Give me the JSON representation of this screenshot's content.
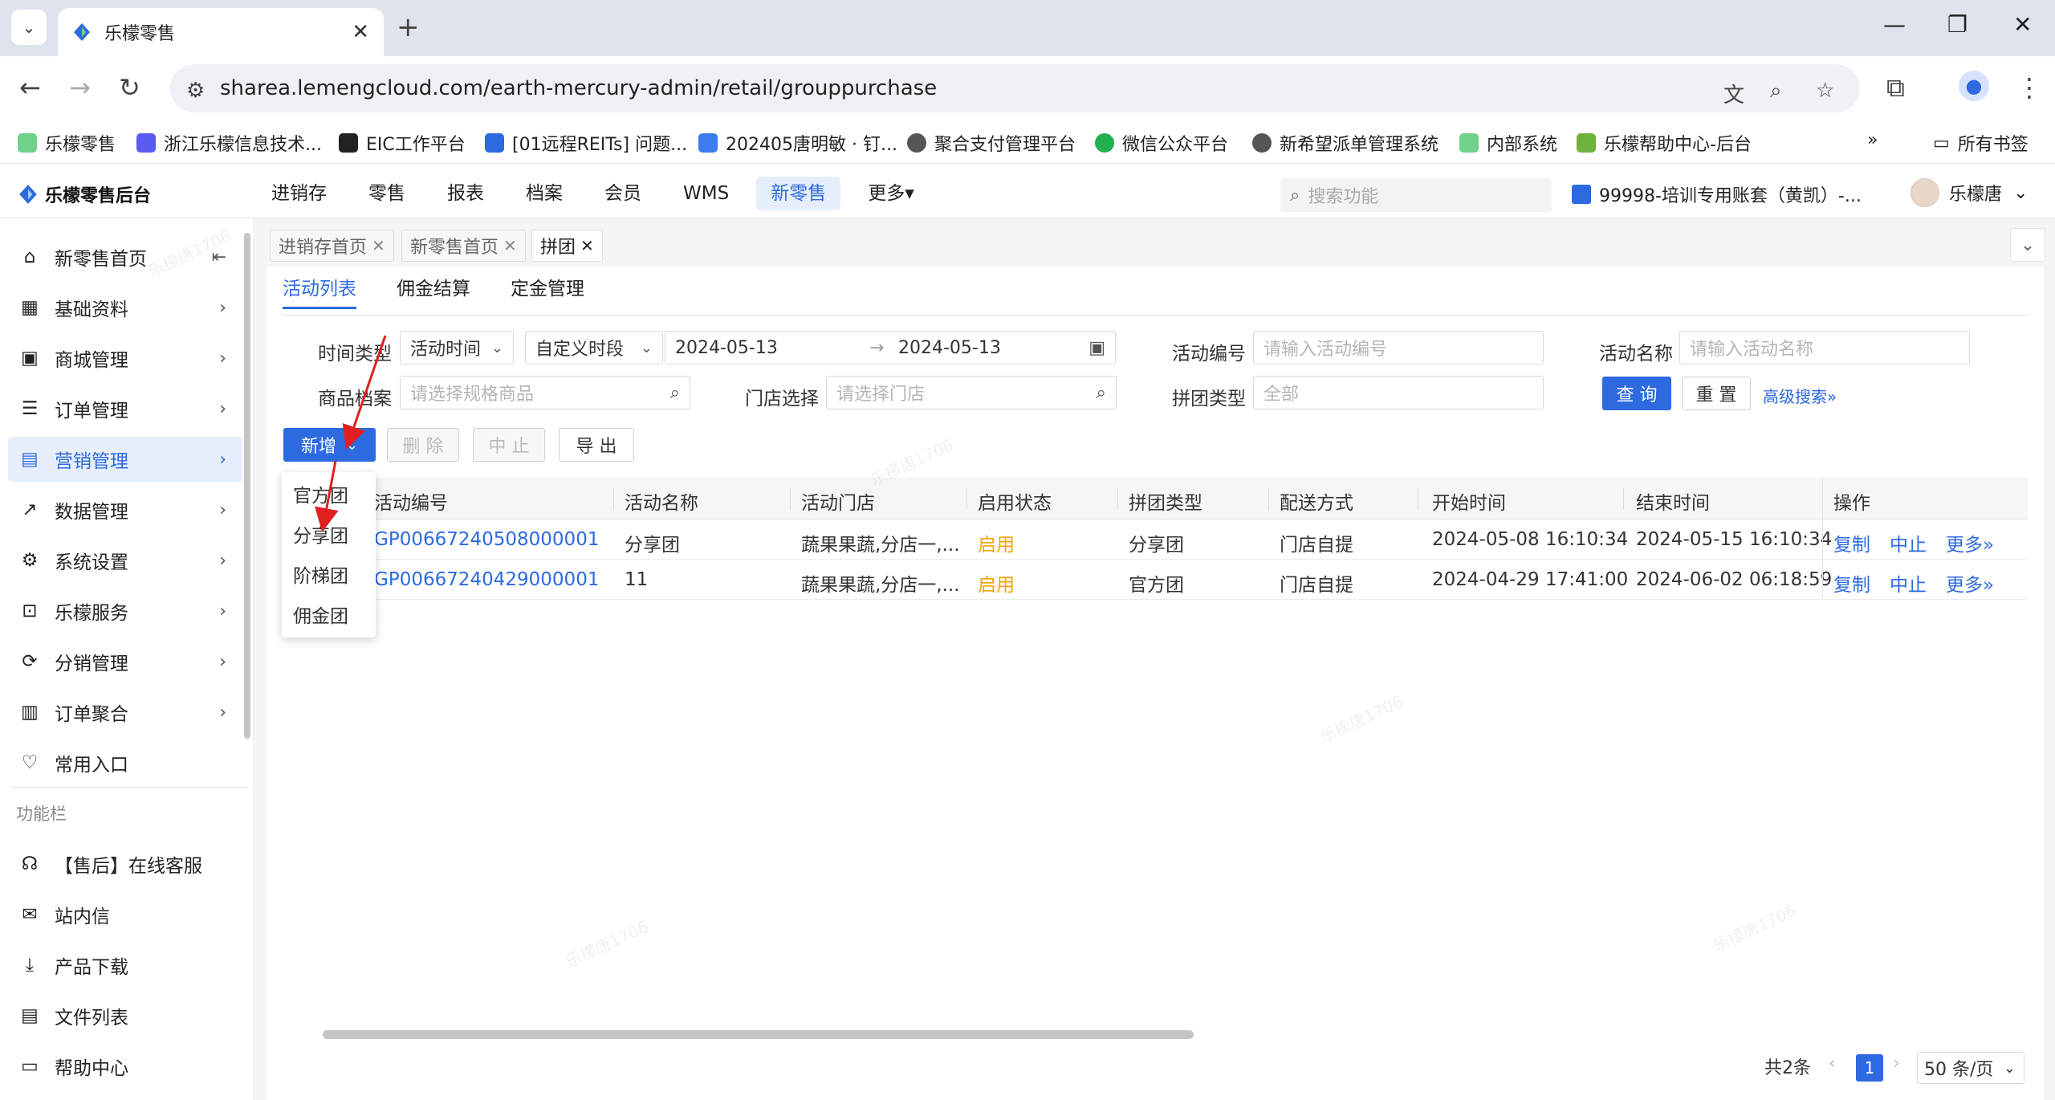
{
  "browser": {
    "tab_title": "乐檬零售",
    "tab_close": "✕",
    "new_tab": "+",
    "url": "sharea.lemengcloud.com/earth-mercury-admin/retail/grouppurchase",
    "bookmarks": [
      "乐檬零售",
      "浙江乐檬信息技术...",
      "EIC工作平台",
      "[01远程REITs] 问题...",
      "202405唐明敏 · 钉...",
      "聚合支付管理平台",
      "微信公众平台",
      "新希望派单管理系统",
      "内部系统",
      "乐檬帮助中心-后台"
    ],
    "more_bookmarks": "»",
    "all_bookmarks": "所有书签"
  },
  "app": {
    "brand": "乐檬零售后台",
    "nav": [
      "进销存",
      "零售",
      "报表",
      "档案",
      "会员",
      "WMS",
      "新零售",
      "更多▾"
    ],
    "search_placeholder": "搜索功能",
    "account": "99998-培训专用账套（黄凯）-...",
    "user": "乐檬唐"
  },
  "sidebar": {
    "items": [
      "新零售首页",
      "基础资料",
      "商城管理",
      "订单管理",
      "营销管理",
      "数据管理",
      "系统设置",
      "乐檬服务",
      "分销管理",
      "订单聚合",
      "常用入口"
    ],
    "section": "功能栏",
    "tools": [
      "【售后】在线客服",
      "站内信",
      "产品下载",
      "文件列表",
      "帮助中心"
    ]
  },
  "tags": [
    "进销存首页",
    "新零售首页",
    "拼团"
  ],
  "subtabs": [
    "活动列表",
    "佣金结算",
    "定金管理"
  ],
  "filters": {
    "time_type_label": "时间类型",
    "time_type_value": "活动时间",
    "period_value": "自定义时段",
    "date_start": "2024-05-13",
    "date_sep": "→",
    "date_end": "2024-05-13",
    "activity_no_label": "活动编号",
    "activity_no_placeholder": "请输入活动编号",
    "activity_name_label": "活动名称",
    "activity_name_placeholder": "请输入活动名称",
    "product_label": "商品档案",
    "product_placeholder": "请选择规格商品",
    "store_label": "门店选择",
    "store_placeholder": "请选择门店",
    "group_type_label": "拼团类型",
    "group_type_placeholder": "全部",
    "query": "查 询",
    "reset": "重 置",
    "advanced": "高级搜索»"
  },
  "actions": {
    "add": "新增",
    "delete": "删 除",
    "stop": "中 止",
    "export": "导 出"
  },
  "add_menu": [
    "官方团",
    "分享团",
    "阶梯团",
    "佣金团"
  ],
  "table": {
    "headers": [
      "活动编号",
      "活动名称",
      "活动门店",
      "启用状态",
      "拼团类型",
      "配送方式",
      "开始时间",
      "结束时间",
      "操作"
    ],
    "rows": [
      {
        "no": "GP00667240508000001",
        "name": "分享团",
        "store": "蔬果果蔬,分店一,...",
        "status": "启用",
        "type": "分享团",
        "delivery": "门店自提",
        "start": "2024-05-08 16:10:34",
        "end": "2024-05-15 16:10:34"
      },
      {
        "no": "GP00667240429000001",
        "name": "11",
        "store": "蔬果果蔬,分店一,...",
        "status": "启用",
        "type": "官方团",
        "delivery": "门店自提",
        "start": "2024-04-29 17:41:00",
        "end": "2024-06-02 06:18:59"
      }
    ],
    "ops": [
      "复制",
      "中止",
      "更多»"
    ]
  },
  "pager": {
    "total": "共2条",
    "page": "1",
    "size": "50 条/页"
  },
  "watermark": "乐檬唐1706"
}
